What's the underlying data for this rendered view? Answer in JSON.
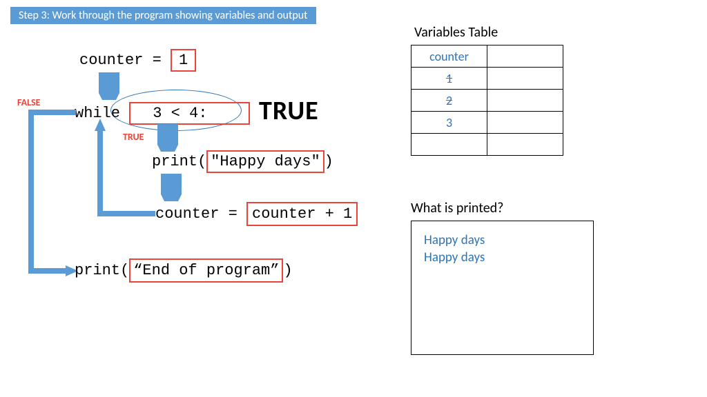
{
  "banner": "Step 3: Work through the program showing variables and output",
  "code": {
    "line1_pre": "counter = ",
    "line1_val": "1",
    "line2_pre": "while ",
    "line2_mid": "3",
    "line2_post": " < 4:",
    "line3_pre": "print(",
    "line3_str": "\"Happy days\"",
    "line3_post": ")",
    "line4_pre": "counter = ",
    "line4_expr": "counter + 1",
    "line5_pre": "print(",
    "line5_str": "“End of program”",
    "line5_post": ")"
  },
  "labels": {
    "false": "FALSE",
    "true_small": "TRUE",
    "true_big": "TRUE"
  },
  "vars_table": {
    "title": "Variables Table",
    "header": "counter",
    "rows": [
      "1",
      "2",
      "3",
      ""
    ],
    "struck": [
      true,
      true,
      false,
      false
    ]
  },
  "output": {
    "title": "What is printed?",
    "lines": [
      "Happy days",
      "Happy days"
    ]
  }
}
